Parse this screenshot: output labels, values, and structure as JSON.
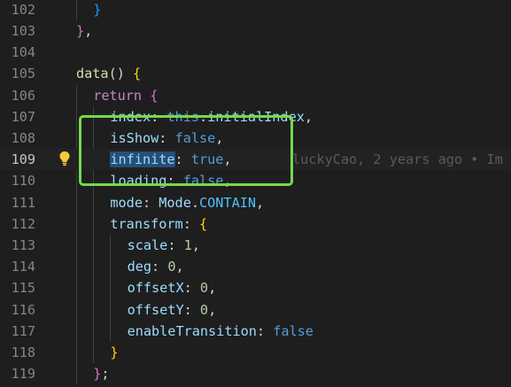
{
  "editor": {
    "lines": [
      {
        "number": "102",
        "indent": 1,
        "tokens": [
          {
            "t": "}",
            "c": "br3"
          }
        ]
      },
      {
        "number": "103",
        "indent": 0,
        "tokens": [
          {
            "t": "}",
            "c": "br2"
          },
          {
            "t": ",",
            "c": "tok-p"
          }
        ]
      },
      {
        "number": "104",
        "indent": 0,
        "tokens": []
      },
      {
        "number": "105",
        "indent": 0,
        "tokens": [
          {
            "t": "data",
            "c": "tok-fn"
          },
          {
            "t": "() ",
            "c": "tok-p"
          },
          {
            "t": "{",
            "c": "br1"
          }
        ]
      },
      {
        "number": "106",
        "indent": 1,
        "tokens": [
          {
            "t": "return",
            "c": "tok-kw"
          },
          {
            "t": " ",
            "c": "tok-p"
          },
          {
            "t": "{",
            "c": "br2"
          }
        ]
      },
      {
        "number": "107",
        "indent": 2,
        "tokens": [
          {
            "t": "index",
            "c": "tok-key"
          },
          {
            "t": ": ",
            "c": "tok-p"
          },
          {
            "t": "this",
            "c": "tok-this"
          },
          {
            "t": ".",
            "c": "tok-p"
          },
          {
            "t": "initialIndex",
            "c": "tok-key"
          },
          {
            "t": ",",
            "c": "tok-p"
          }
        ]
      },
      {
        "number": "108",
        "indent": 2,
        "tokens": [
          {
            "t": "isShow",
            "c": "tok-key"
          },
          {
            "t": ": ",
            "c": "tok-p"
          },
          {
            "t": "false",
            "c": "tok-bool"
          },
          {
            "t": ",",
            "c": "tok-p"
          }
        ]
      },
      {
        "number": "109",
        "indent": 2,
        "current": true,
        "tokens": [
          {
            "t": "infinite",
            "c": "tok-key hl-word"
          },
          {
            "t": ": ",
            "c": "tok-p"
          },
          {
            "t": "true",
            "c": "tok-bool"
          },
          {
            "t": ",",
            "c": "tok-p"
          }
        ],
        "blame": "luckyCao, 2 years ago • Im"
      },
      {
        "number": "110",
        "indent": 2,
        "tokens": [
          {
            "t": "loading",
            "c": "tok-key"
          },
          {
            "t": ": ",
            "c": "tok-p"
          },
          {
            "t": "false",
            "c": "tok-bool"
          },
          {
            "t": ",",
            "c": "tok-p"
          }
        ]
      },
      {
        "number": "111",
        "indent": 2,
        "tokens": [
          {
            "t": "mode",
            "c": "tok-key"
          },
          {
            "t": ": ",
            "c": "tok-p"
          },
          {
            "t": "Mode",
            "c": "tok-key"
          },
          {
            "t": ".",
            "c": "tok-p"
          },
          {
            "t": "CONTAIN",
            "c": "tok-const"
          },
          {
            "t": ",",
            "c": "tok-p"
          }
        ]
      },
      {
        "number": "112",
        "indent": 2,
        "tokens": [
          {
            "t": "transform",
            "c": "tok-key"
          },
          {
            "t": ": ",
            "c": "tok-p"
          },
          {
            "t": "{",
            "c": "br1"
          }
        ]
      },
      {
        "number": "113",
        "indent": 3,
        "tokens": [
          {
            "t": "scale",
            "c": "tok-key"
          },
          {
            "t": ": ",
            "c": "tok-p"
          },
          {
            "t": "1",
            "c": "tok-num"
          },
          {
            "t": ",",
            "c": "tok-p"
          }
        ]
      },
      {
        "number": "114",
        "indent": 3,
        "tokens": [
          {
            "t": "deg",
            "c": "tok-key"
          },
          {
            "t": ": ",
            "c": "tok-p"
          },
          {
            "t": "0",
            "c": "tok-num"
          },
          {
            "t": ",",
            "c": "tok-p"
          }
        ]
      },
      {
        "number": "115",
        "indent": 3,
        "tokens": [
          {
            "t": "offsetX",
            "c": "tok-key"
          },
          {
            "t": ": ",
            "c": "tok-p"
          },
          {
            "t": "0",
            "c": "tok-num"
          },
          {
            "t": ",",
            "c": "tok-p"
          }
        ]
      },
      {
        "number": "116",
        "indent": 3,
        "tokens": [
          {
            "t": "offsetY",
            "c": "tok-key"
          },
          {
            "t": ": ",
            "c": "tok-p"
          },
          {
            "t": "0",
            "c": "tok-num"
          },
          {
            "t": ",",
            "c": "tok-p"
          }
        ]
      },
      {
        "number": "117",
        "indent": 3,
        "tokens": [
          {
            "t": "enableTransition",
            "c": "tok-key"
          },
          {
            "t": ": ",
            "c": "tok-p"
          },
          {
            "t": "false",
            "c": "tok-bool"
          }
        ]
      },
      {
        "number": "118",
        "indent": 2,
        "tokens": [
          {
            "t": "}",
            "c": "br1"
          }
        ]
      },
      {
        "number": "119",
        "indent": 1,
        "tokens": [
          {
            "t": "}",
            "c": "br2"
          },
          {
            "t": ";",
            "c": "tok-p"
          }
        ]
      }
    ]
  },
  "colors": {
    "background": "#1e1e1e",
    "annotation": "#76d94a",
    "lightbulb": "#f4c93b"
  }
}
